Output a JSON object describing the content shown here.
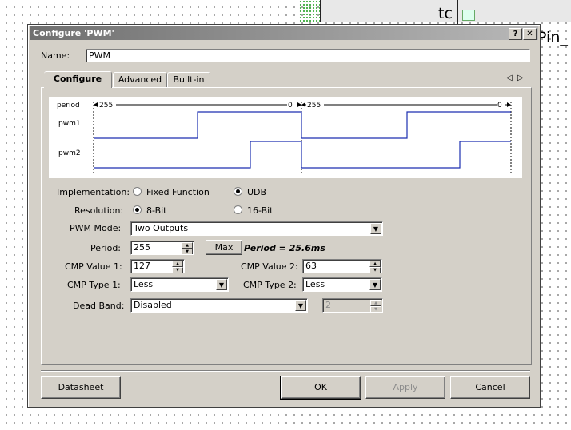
{
  "background": {
    "block_label": "tc",
    "pin_label": "Pin_"
  },
  "dialog": {
    "title": "Configure 'PWM'",
    "help_button": "?",
    "close_button": "✕",
    "name_label": "Name:",
    "name_value": "PWM",
    "tabs": [
      {
        "label": "Configure",
        "active": true
      },
      {
        "label": "Advanced",
        "active": false
      },
      {
        "label": "Built-in",
        "active": false
      }
    ],
    "scroll_left": "◁",
    "scroll_right": "▷",
    "waveform": {
      "period_label": "period",
      "pwm1_label": "pwm1",
      "pwm2_label": "pwm2",
      "start_count": "255",
      "end_count": "0",
      "start_count_2": "255",
      "end_count_2": "0"
    },
    "implementation": {
      "label": "Implementation:",
      "options": [
        "Fixed Function",
        "UDB"
      ],
      "selected": "UDB"
    },
    "resolution": {
      "label": "Resolution:",
      "options": [
        "8-Bit",
        "16-Bit"
      ],
      "selected": "8-Bit"
    },
    "pwm_mode": {
      "label": "PWM Mode:",
      "value": "Two Outputs"
    },
    "period": {
      "label": "Period:",
      "value": "255",
      "max_button": "Max",
      "period_text": "Period = 25.6ms"
    },
    "cmp1": {
      "label": "CMP Value 1:",
      "value": "127"
    },
    "cmp2": {
      "label": "CMP Value 2:",
      "value": "63"
    },
    "cmp_type1": {
      "label": "CMP Type 1:",
      "value": "Less"
    },
    "cmp_type2": {
      "label": "CMP Type 2:",
      "value": "Less"
    },
    "dead_band": {
      "label": "Dead Band:",
      "value": "Disabled",
      "count": "2"
    },
    "buttons": {
      "datasheet": "Datasheet",
      "ok": "OK",
      "apply": "Apply",
      "cancel": "Cancel"
    },
    "colors": {
      "titlebar": "#8a8a8a",
      "face": "#d4d0c8",
      "waveform": "#1c2fb0",
      "disabled_text": "#8c8c8c"
    }
  }
}
